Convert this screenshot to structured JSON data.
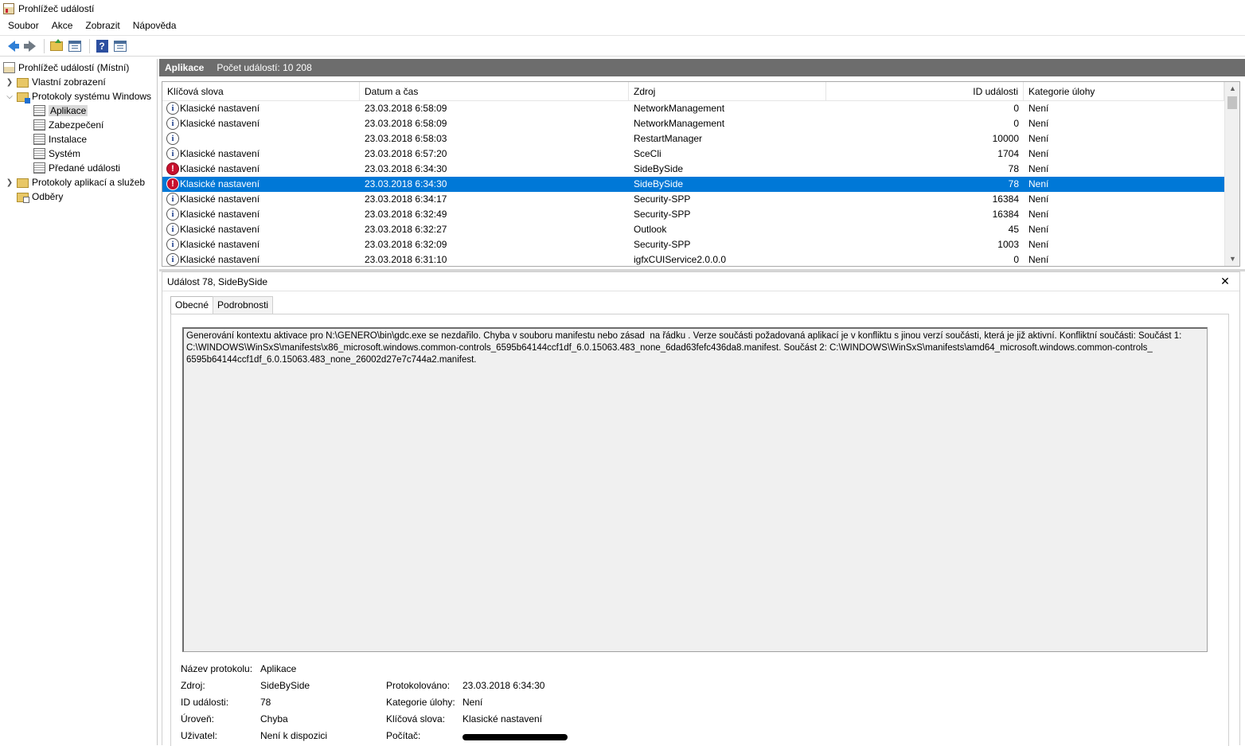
{
  "window": {
    "title": "Prohlížeč událostí"
  },
  "menu": [
    "Soubor",
    "Akce",
    "Zobrazit",
    "Nápověda"
  ],
  "tree": [
    {
      "label": "Prohlížeč událostí (Místní)",
      "icon": "event-viewer-icon"
    },
    {
      "label": "Vlastní zobrazení",
      "icon": "folder-icon"
    },
    {
      "label": "Protokoly systému Windows",
      "icon": "windows-folder-icon"
    },
    {
      "label": "Aplikace",
      "icon": "log-icon"
    },
    {
      "label": "Zabezpečení",
      "icon": "log-icon"
    },
    {
      "label": "Instalace",
      "icon": "log-icon"
    },
    {
      "label": "Systém",
      "icon": "log-icon"
    },
    {
      "label": "Předané události",
      "icon": "log-icon"
    },
    {
      "label": "Protokoly aplikací a služeb",
      "icon": "folder-icon"
    },
    {
      "label": "Odběry",
      "icon": "subscription-icon"
    }
  ],
  "list_header": {
    "title": "Aplikace",
    "count": "Počet událostí: 10 208"
  },
  "columns": [
    "Klíčová slova",
    "Datum a čas",
    "Zdroj",
    "ID události",
    "Kategorie úlohy"
  ],
  "rows": [
    {
      "level": "info",
      "keywords": "Klasické nastavení",
      "date": "23.03.2018 6:58:09",
      "source": "NetworkManagement",
      "id": "0",
      "category": "Není"
    },
    {
      "level": "info",
      "keywords": "Klasické nastavení",
      "date": "23.03.2018 6:58:09",
      "source": "NetworkManagement",
      "id": "0",
      "category": "Není"
    },
    {
      "level": "info",
      "keywords": "",
      "date": "23.03.2018 6:58:03",
      "source": "RestartManager",
      "id": "10000",
      "category": "Není"
    },
    {
      "level": "info",
      "keywords": "Klasické nastavení",
      "date": "23.03.2018 6:57:20",
      "source": "SceCli",
      "id": "1704",
      "category": "Není"
    },
    {
      "level": "error",
      "keywords": "Klasické nastavení",
      "date": "23.03.2018 6:34:30",
      "source": "SideBySide",
      "id": "78",
      "category": "Není"
    },
    {
      "level": "error",
      "keywords": "Klasické nastavení",
      "date": "23.03.2018 6:34:30",
      "source": "SideBySide",
      "id": "78",
      "category": "Není",
      "selected": true
    },
    {
      "level": "info",
      "keywords": "Klasické nastavení",
      "date": "23.03.2018 6:34:17",
      "source": "Security-SPP",
      "id": "16384",
      "category": "Není"
    },
    {
      "level": "info",
      "keywords": "Klasické nastavení",
      "date": "23.03.2018 6:32:49",
      "source": "Security-SPP",
      "id": "16384",
      "category": "Není"
    },
    {
      "level": "info",
      "keywords": "Klasické nastavení",
      "date": "23.03.2018 6:32:27",
      "source": "Outlook",
      "id": "45",
      "category": "Není"
    },
    {
      "level": "info",
      "keywords": "Klasické nastavení",
      "date": "23.03.2018 6:32:09",
      "source": "Security-SPP",
      "id": "1003",
      "category": "Není"
    },
    {
      "level": "info",
      "keywords": "Klasické nastavení",
      "date": "23.03.2018 6:31:10",
      "source": "igfxCUIService2.0.0.0",
      "id": "0",
      "category": "Není"
    }
  ],
  "detail": {
    "title": "Událost 78, SideBySide",
    "tabs": [
      "Obecné",
      "Podrobnosti"
    ],
    "description": "Generování kontextu aktivace pro N:\\GENERO\\bin\\gdc.exe se nezdařilo. Chyba v souboru manifestu nebo zásad  na řádku . Verze součásti požadovaná aplikací je v konfliktu s jinou verzí součásti, která je již aktivní. Konfliktní součásti: Součást 1:\nC:\\WINDOWS\\WinSxS\\manifests\\x86_microsoft.windows.common-controls_6595b64144ccf1df_6.0.15063.483_none_6dad63fefc436da8.manifest. Součást 2: C:\\WINDOWS\\WinSxS\\manifests\\amd64_microsoft.windows.common-controls_\n6595b64144ccf1df_6.0.15063.483_none_26002d27e7c744a2.manifest.",
    "props": {
      "log_name_label": "Název protokolu:",
      "log_name": "Aplikace",
      "source_label": "Zdroj:",
      "source": "SideBySide",
      "logged_label": "Protokolováno:",
      "logged": "23.03.2018 6:34:30",
      "event_id_label": "ID události:",
      "event_id": "78",
      "category_label": "Kategorie úlohy:",
      "category": "Není",
      "level_label": "Úroveň:",
      "level": "Chyba",
      "keywords_label": "Klíčová slova:",
      "keywords": "Klasické nastavení",
      "user_label": "Uživatel:",
      "user": "Není k dispozici",
      "computer_label": "Počítač:"
    }
  },
  "colors": {
    "selection": "#0078d7",
    "header_bar": "#6d6d6d",
    "error": "#c8102e"
  }
}
